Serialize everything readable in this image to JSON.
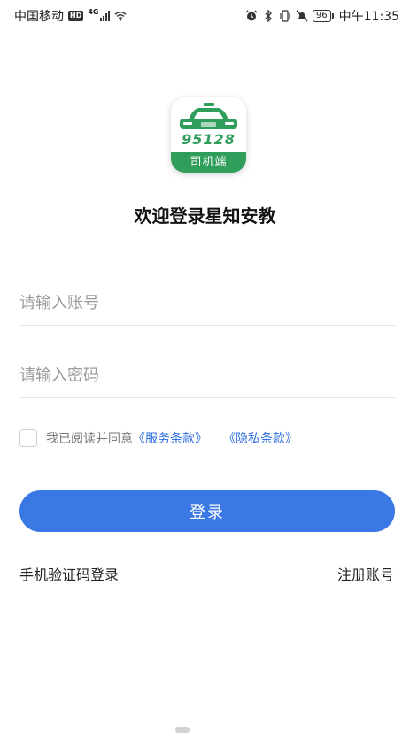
{
  "status_bar": {
    "carrier": "中国移动",
    "hd_badge": "HD",
    "network_type": "4G",
    "battery": "96",
    "time": "中午11:35",
    "icons": [
      "alarm-icon",
      "bluetooth-icon",
      "vibrate-icon",
      "mute-icon",
      "wifi-icon",
      "signal-icon"
    ]
  },
  "logo": {
    "number": "95128",
    "caption": "司机端",
    "brand_color": "#2f9e5b"
  },
  "title": "欢迎登录星知安教",
  "form": {
    "account_placeholder": "请输入账号",
    "password_placeholder": "请输入密码",
    "agreement_prefix": "我已阅读并同意",
    "terms_link": "《服务条款》",
    "privacy_link": "《隐私条款》",
    "login_label": "登录",
    "accent_color": "#3a78e6"
  },
  "footer": {
    "sms_login": "手机验证码登录",
    "register": "注册账号"
  }
}
